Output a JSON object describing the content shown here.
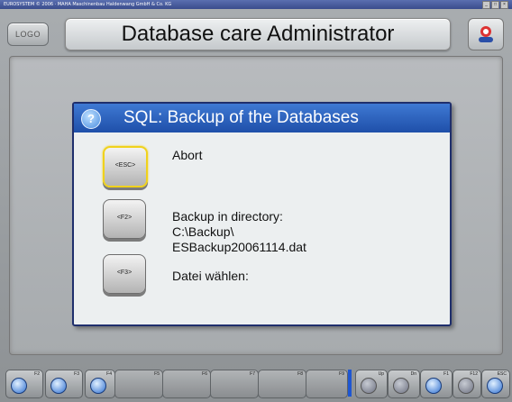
{
  "window": {
    "titlebar_text": "EUROSYSTEM © 2006 · MAHA Maschinenbau Haldenwang GmbH & Co. KG",
    "controls": [
      "_",
      "□",
      "×"
    ]
  },
  "header": {
    "logo_label": "LOGO",
    "title": "Database care Administrator"
  },
  "dialog": {
    "title": "SQL: Backup of the Databases",
    "help_symbol": "?",
    "options": [
      {
        "key": "<ESC>",
        "lines": [
          "Abort"
        ],
        "focused": true
      },
      {
        "key": "<F2>",
        "lines": [
          "Backup in directory:",
          "C:\\Backup\\",
          "ESBackup20061114.dat"
        ],
        "focused": false
      },
      {
        "key": "<F3>",
        "lines": [
          "Datei wählen:"
        ],
        "focused": false
      }
    ]
  },
  "footer": {
    "keys": [
      {
        "label": "F2",
        "icon": "back-arrow-icon",
        "active": true
      },
      {
        "label": "F3",
        "icon": "forward-arrow-icon",
        "active": true
      },
      {
        "label": "F4",
        "icon": "home-icon",
        "active": true
      },
      {
        "label": "F5",
        "icon": "",
        "active": false
      },
      {
        "label": "F6",
        "icon": "",
        "active": false
      },
      {
        "label": "F7",
        "icon": "",
        "active": false
      },
      {
        "label": "F8",
        "icon": "",
        "active": false
      },
      {
        "label": "F9",
        "icon": "",
        "active": false
      },
      {
        "label": "Up",
        "icon": "page-up-icon",
        "active": false
      },
      {
        "label": "Dn",
        "icon": "page-down-icon",
        "active": false
      },
      {
        "label": "F1",
        "icon": "help-icon",
        "active": true
      },
      {
        "label": "F12",
        "icon": "tools-icon",
        "active": false
      },
      {
        "label": "ESC",
        "icon": "exit-icon",
        "active": true
      }
    ]
  },
  "colors": {
    "dialog_header": "#2f63bf",
    "focus_ring": "#f0d21c",
    "accent_blue": "#1e56d2"
  }
}
